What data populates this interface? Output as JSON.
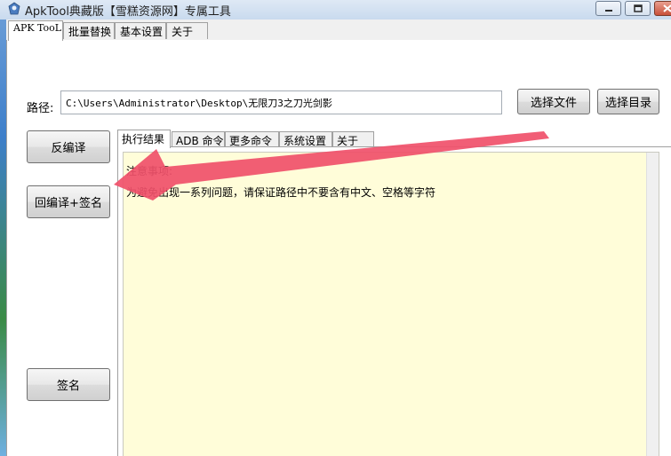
{
  "window": {
    "title": "ApkTool典藏版【雪糕资源网】专属工具",
    "min_icon": "minimize-icon",
    "max_icon": "maximize-icon",
    "close_icon": "close-icon"
  },
  "tabs": [
    "APK TooL",
    "批量替换",
    "基本设置",
    "关于"
  ],
  "path": {
    "label": "路径:",
    "value": "C:\\Users\\Administrator\\Desktop\\无限刀3之刀光剑影"
  },
  "buttons": {
    "select_file": "选择文件",
    "select_dir": "选择目录",
    "decompile": "反编译",
    "recompile_sign": "回编译+签名",
    "sign": "签名"
  },
  "inner_tabs": [
    "执行结果",
    "ADB 命令",
    "更多命令",
    "系统设置",
    "关于"
  ],
  "output": {
    "line1": "注意事项:",
    "line2": "为避免出现一系列问题，请保证路径中不要含有中文、空格等字符"
  },
  "colors": {
    "output_bg": "#fffdd9",
    "arrow": "#f0506a"
  }
}
